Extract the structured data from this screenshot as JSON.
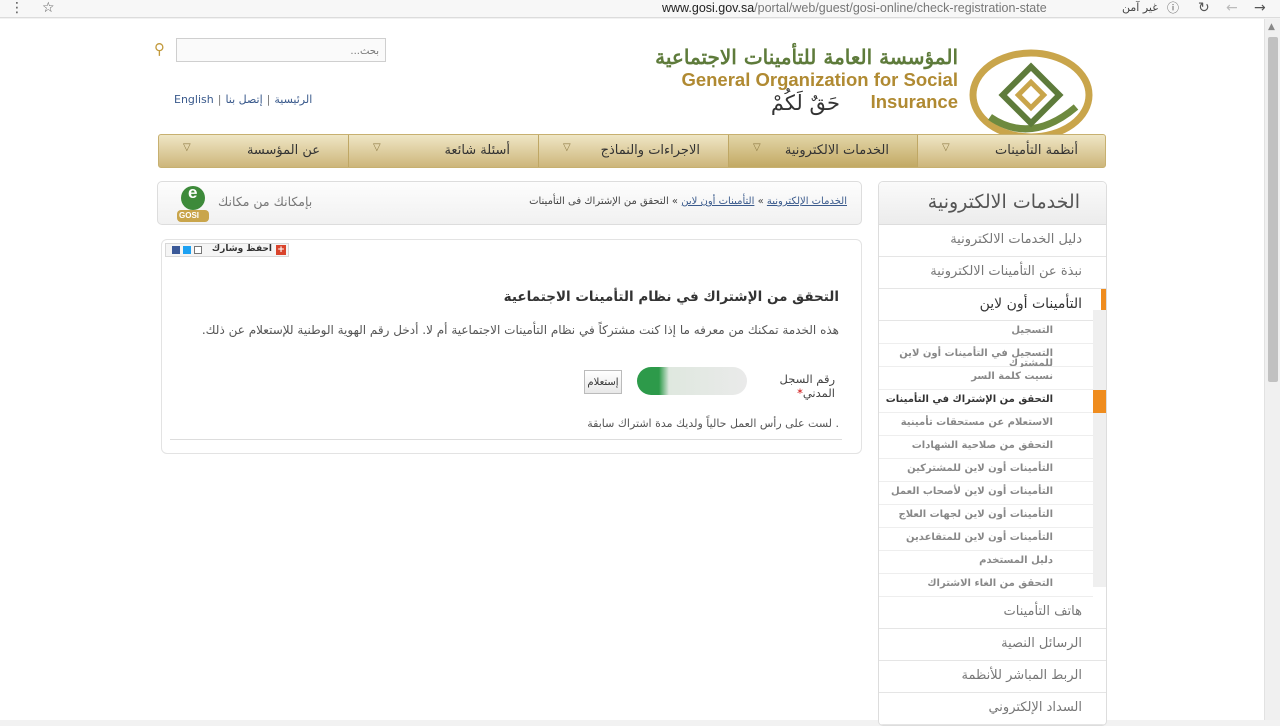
{
  "browser": {
    "url_domain": "www.gosi.gov.sa",
    "url_path": "/portal/web/guest/gosi-online/check-registration-state",
    "security_label": "غير آمن"
  },
  "header": {
    "title_ar": "المؤسسة العامة للتأمينات الاجتماعية",
    "title_en": "General Organization for Social Insurance",
    "slogan": "حَقٌ لَكُمْ",
    "search_placeholder": "بحث...",
    "links": {
      "english": "English",
      "contact": "إتصل بنا",
      "home": "الرئيسية"
    }
  },
  "nav": [
    {
      "label": "أنظمة التأمينات"
    },
    {
      "label": "الخدمات الالكترونية"
    },
    {
      "label": "الاجراءات والنماذج"
    },
    {
      "label": "أسئلة شائعة"
    },
    {
      "label": "عن المؤسسة"
    }
  ],
  "breadcrumb": {
    "c1": "الخدمات الإلكترونية",
    "sep": "»",
    "c2": "التأمينات أون لاين",
    "c3": "التحقق من الإشتراك فى التأمينات"
  },
  "eslogan": "بإمكانك من مكانك",
  "egosi": {
    "e": "e",
    "gosi": "GOSI"
  },
  "share": {
    "label": "احفظ وشارك"
  },
  "content": {
    "title": "التحقق من الإشتراك في نظام التأمينات الاجتماعية",
    "description": "هذه الخدمة تمكنك من معرفه ما إذا كنت مشتركاً في نظام التأمينات الاجتماعية أم لا. أدخل رقم الهوية الوطنية للإستعلام عن ذلك.",
    "field_label": "رقم السجل المدني",
    "required_mark": "*",
    "submit": "إستعلام",
    "note": ". لست على رأس العمل حالياً ولديك مدة اشتراك سابقة"
  },
  "sidebar": {
    "title": "الخدمات الالكترونية",
    "items_top": [
      "دليل الخدمات الالكترونية",
      "نبذة عن التأمينات الالكترونية"
    ],
    "active": "التأمينات أون لاين",
    "subs": [
      "التسجيل",
      "التسجيل في التأمينات أون لاين للمشترك",
      "نسيت كلمة السر",
      "التحقق من الإشتراك في التأمينات",
      "الاستعلام عن مستحقات تأمينية",
      "التحقق من صلاحية الشهادات",
      "التأمينات أون لاين للمشتركين",
      "التأمينات أون لاين لأصحاب العمل",
      "التأمينات أون لاين لجهات العلاج",
      "التأمينات أون لاين للمتقاعدين",
      "دليل المستخدم",
      "التحقق من الغاء الاشتراك"
    ],
    "items_bottom": [
      "هاتف التأمينات",
      "الرسائل النصية",
      "الربط المباشر للأنظمة",
      "السداد الإلكتروني"
    ]
  }
}
